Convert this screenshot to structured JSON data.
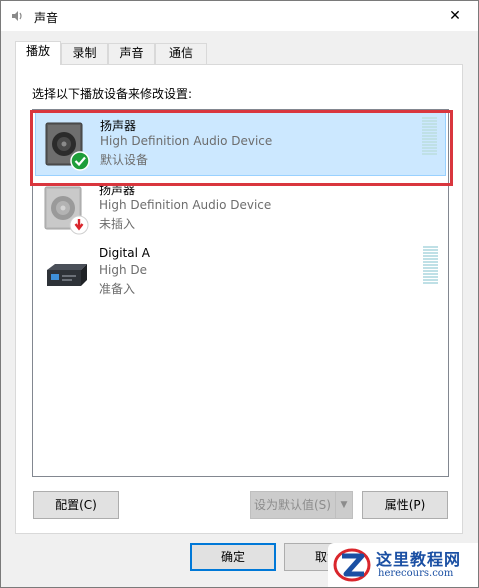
{
  "window": {
    "title": "声音",
    "close_glyph": "✕"
  },
  "tabs": [
    {
      "label": "播放",
      "active": true
    },
    {
      "label": "录制",
      "active": false
    },
    {
      "label": "声音",
      "active": false
    },
    {
      "label": "通信",
      "active": false
    }
  ],
  "panel": {
    "instruction": "选择以下播放设备来修改设置:"
  },
  "devices": [
    {
      "name": "扬声器",
      "description": "High Definition Audio Device",
      "status": "默认设备",
      "badge": "check",
      "selected": true,
      "icon": "speaker-icon"
    },
    {
      "name": "扬声器",
      "description": "High Definition Audio Device",
      "status": "未插入",
      "badge": "unplugged-arrow",
      "selected": false,
      "icon": "speaker-icon"
    },
    {
      "name": "Digital A",
      "description": "High De",
      "status": "准备入",
      "badge": "none",
      "selected": false,
      "icon": "digital-output-icon"
    }
  ],
  "buttons": {
    "configure": "配置(C)",
    "set_default": "设为默认值(S)",
    "properties": "属性(P)",
    "ok": "确定",
    "cancel": "取消"
  },
  "watermark": {
    "title": "这里教程网",
    "url": "herecours.com"
  },
  "colors": {
    "selection_bg": "#cce8ff",
    "highlight_border": "#d9363e",
    "check_green": "#1e9e3a",
    "unplugged_red": "#d9262c",
    "watermark_blue": "#1a4fa3"
  }
}
